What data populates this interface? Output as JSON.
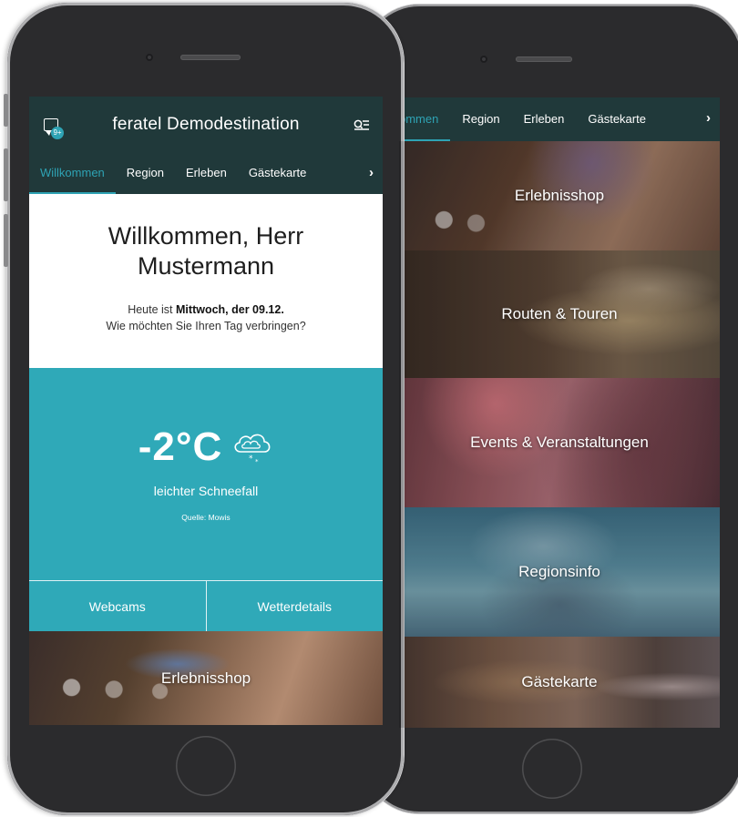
{
  "front_screen": {
    "header": {
      "title": "feratel Demodestination",
      "chat_badge": "9+",
      "icons": [
        "chat-icon",
        "search-menu-icon"
      ]
    },
    "tabs": [
      {
        "label": "Willkommen",
        "active": true
      },
      {
        "label": "Region",
        "active": false
      },
      {
        "label": "Erleben",
        "active": false
      },
      {
        "label": "Gästekarte",
        "active": false
      }
    ],
    "tabs_next": "›",
    "welcome": {
      "title_line1": "Willkommen, Herr",
      "title_line2": "Mustermann",
      "date_prefix": "Heute ist ",
      "date_bold": "Mittwoch, der 09.12.",
      "question": "Wie möchten Sie Ihren Tag verbringen?"
    },
    "weather": {
      "temperature": "-2°C",
      "condition": "leichter Schneefall",
      "source": "Quelle: Mowis",
      "icon": "cloud-snow-icon"
    },
    "weather_buttons": [
      "Webcams",
      "Wetterdetails"
    ],
    "tile": {
      "label": "Erlebnisshop"
    }
  },
  "back_screen": {
    "tabs": [
      {
        "label": "ommen",
        "active": true
      },
      {
        "label": "Region",
        "active": false
      },
      {
        "label": "Erleben",
        "active": false
      },
      {
        "label": "Gästekarte",
        "active": false
      }
    ],
    "tabs_next": "›",
    "tiles": [
      {
        "label": "Erlebnisshop"
      },
      {
        "label": "Routen & Touren"
      },
      {
        "label": "Events & Veranstaltungen"
      },
      {
        "label": "Regionsinfo"
      },
      {
        "label": "Gästekarte"
      }
    ]
  },
  "colors": {
    "header": "#20393a",
    "accent": "#2ea3b4",
    "weather_bg": "#2fa9b8",
    "phone_body": "#2b2b2d"
  }
}
